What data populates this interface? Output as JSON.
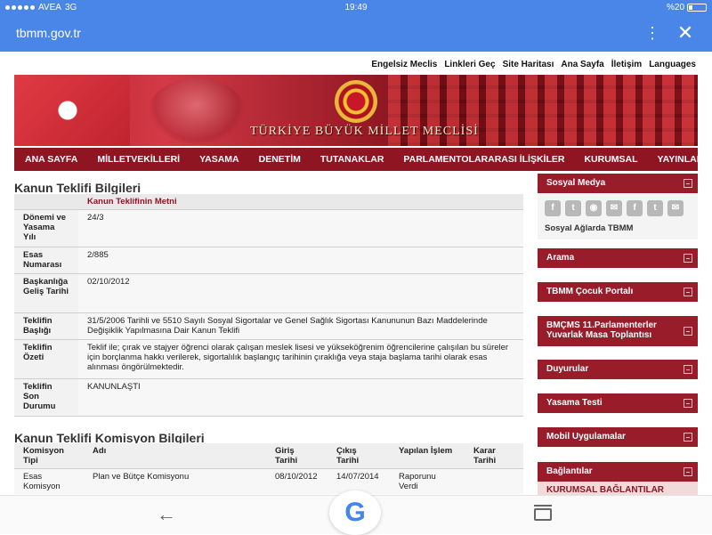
{
  "status_bar": {
    "carrier": "AVEA",
    "network": "3G",
    "time": "19:49",
    "battery": "%20"
  },
  "browser": {
    "url": "tbmm.gov.tr",
    "menu_icon": "more-vert-icon",
    "close_icon": "close-icon"
  },
  "top_links": [
    "Engelsiz Meclis",
    "Linkleri Geç",
    "Site Haritası",
    "Ana Sayfa",
    "İletişim",
    "Languages"
  ],
  "banner": {
    "title": "TÜRKİYE BÜYÜK MİLLET MECLİSİ"
  },
  "nav": [
    "ANA SAYFA",
    "MİLLETVEKİLLERİ",
    "YASAMA",
    "DENETİM",
    "TUTANAKLAR",
    "PARLAMENTOLARARASI İLİŞKİLER",
    "KURUMSAL",
    "YAYINLAR"
  ],
  "info": {
    "title": "Kanun Teklifi Bilgileri",
    "header_link": "Kanun Teklifinin Metni",
    "rows": [
      {
        "label": "Dönemi ve Yasama Yılı",
        "value": "24/3"
      },
      {
        "label": "Esas Numarası",
        "value": "2/885"
      },
      {
        "label": "Başkanlığa Geliş Tarihi",
        "value": "02/10/2012"
      },
      {
        "label": "Teklifin Başlığı",
        "value": "31/5/2006 Tarihli ve 5510 Sayılı Sosyal Sigortalar ve Genel Sağlık Sigortası Kanununun Bazı Maddelerinde Değişiklik Yapılmasına Dair Kanun Teklifi"
      },
      {
        "label": "Teklifin Özeti",
        "value": "Teklif ile; çırak ve stajyer öğrenci olarak çalışan meslek lisesi ve yükseköğrenim öğrencilerine çalışılan bu süreler için borçlanma hakkı verilerek, sigortalılık başlangıç tarihinin çıraklığa veya staja başlama tarihi olarak esas alınması öngörülmektedir."
      },
      {
        "label": "Teklifin Son Durumu",
        "value": "KANUNLAŞTI"
      }
    ]
  },
  "komisyon": {
    "title": "Kanun Teklifi Komisyon Bilgileri",
    "columns": [
      "Komisyon Tipi",
      "Adı",
      "Giriş Tarihi",
      "Çıkış Tarihi",
      "Yapılan İşlem",
      "Karar Tarihi"
    ],
    "rows": [
      [
        "Esas Komisyon",
        "Plan ve Bütçe Komisyonu",
        "08/10/2012",
        "14/07/2014",
        "Raporunu Verdi",
        ""
      ]
    ]
  },
  "sidebar": {
    "social_title": "Sosyal Medya",
    "social_icons": [
      "f",
      "t",
      "rss",
      "mail",
      "f",
      "t",
      "mail"
    ],
    "social_caption": "Sosyal Ağlarda TBMM",
    "boxes": [
      "Arama",
      "TBMM Çocuk Portalı",
      "BMÇMS 11.Parlamenterler Yuvarlak Masa Toplantısı",
      "Duyurular",
      "Yasama Testi",
      "Mobil Uygulamalar",
      "Bağlantılar"
    ],
    "sub_link": "KURUMSAL BAĞLANTILAR"
  },
  "bottom_nav": {
    "back_icon": "back-arrow-icon",
    "google_label": "G",
    "tabs_icon": "tabs-icon"
  }
}
